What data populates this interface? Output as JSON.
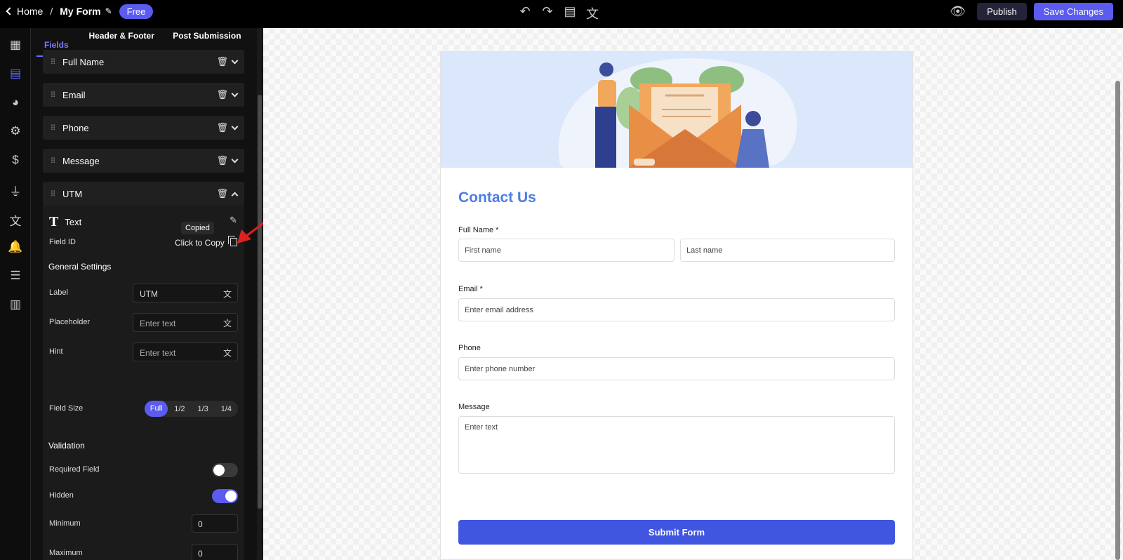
{
  "topbar": {
    "home_label": "Home",
    "separator": "/",
    "form_title": "My Form",
    "plan_badge": "Free",
    "publish_label": "Publish",
    "save_label": "Save Changes"
  },
  "panel": {
    "tabs": [
      {
        "label": "Fields"
      },
      {
        "label": "Header & Footer"
      },
      {
        "label": "Post Submission"
      }
    ],
    "fields": [
      {
        "label": "Full Name"
      },
      {
        "label": "Email"
      },
      {
        "label": "Phone"
      },
      {
        "label": "Message"
      },
      {
        "label": "UTM"
      }
    ],
    "utm": {
      "field_type": "Text",
      "tooltip": "Copied",
      "field_id_label": "Field ID",
      "copy_label": "Click to Copy",
      "general_heading": "General Settings",
      "label_label": "Label",
      "label_value": "UTM",
      "placeholder_label": "Placeholder",
      "placeholder_value": "Enter text",
      "hint_label": "Hint",
      "hint_value": "Enter text",
      "size_label": "Field Size",
      "size_options": [
        "Full",
        "1/2",
        "1/3",
        "1/4"
      ],
      "size_selected": "Full",
      "validation_heading": "Validation",
      "required_label": "Required Field",
      "required_on": false,
      "hidden_label": "Hidden",
      "hidden_on": true,
      "minimum_label": "Minimum",
      "minimum_value": "0",
      "maximum_label": "Maximum",
      "maximum_value": "0"
    }
  },
  "form": {
    "title": "Contact Us",
    "full_name_label": "Full Name *",
    "first_name_placeholder": "First name",
    "last_name_placeholder": "Last name",
    "email_label": "Email *",
    "email_placeholder": "Enter email address",
    "phone_label": "Phone",
    "phone_placeholder": "Enter phone number",
    "message_label": "Message",
    "message_placeholder": "Enter text",
    "submit_label": "Submit Form"
  },
  "colors": {
    "accent": "#5b5bf0",
    "form_title": "#4d7de5",
    "submit": "#4055e0",
    "arrow": "#e02020"
  },
  "icons": {
    "rail": [
      "dashboard-icon",
      "table-icon",
      "palette-icon",
      "gear-icon",
      "dollar-icon",
      "plug-icon",
      "translate-icon",
      "bell-icon",
      "list-icon",
      "chart-icon"
    ],
    "toolbar": [
      "undo-icon",
      "redo-icon",
      "paint-roller-icon",
      "translate-icon"
    ]
  }
}
